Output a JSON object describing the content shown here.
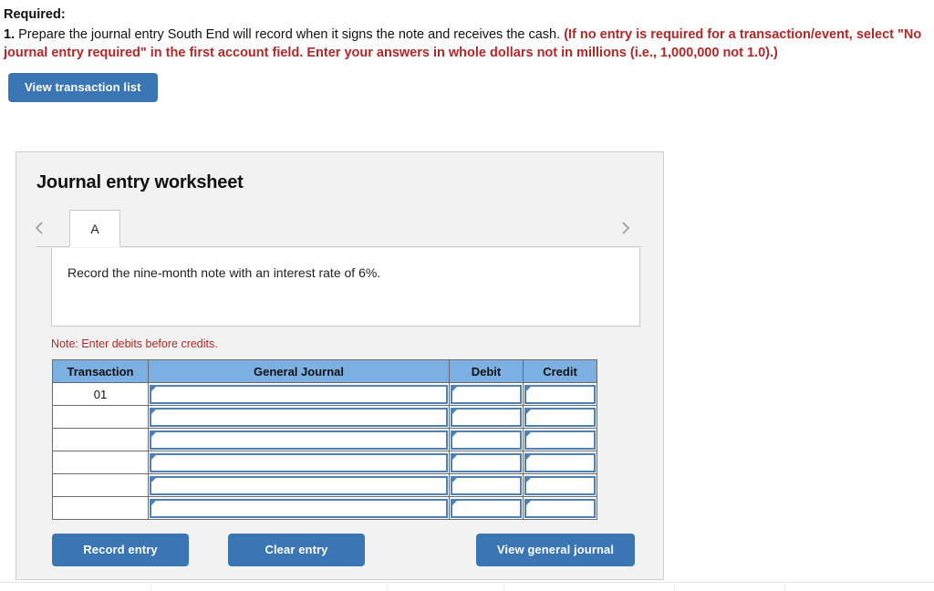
{
  "colors": {
    "button_blue": "#3a76b4",
    "table_header_blue": "#7db0e2",
    "field_border_blue": "#4e80b8",
    "warning_red": "#b02828",
    "panel_gray": "#f2f2f2"
  },
  "instructions": {
    "required_label": "Required:",
    "question_number": "1.",
    "question_text": " Prepare the journal entry South End will record when it signs the note and receives the cash. ",
    "parenthetical": "(If no entry is required for a transaction/event, select \"No journal entry required\" in the first account field. Enter your answers in whole dollars not in millions (i.e., 1,000,000 not 1.0).)"
  },
  "toolbar": {
    "view_transaction_list_label": "View transaction list"
  },
  "worksheet": {
    "title": "Journal entry worksheet",
    "prev_icon": "chevron-left-icon",
    "next_icon": "chevron-right-icon",
    "tabs": [
      {
        "label": "A",
        "active": true
      }
    ],
    "description": "Record the nine-month note with an interest rate of 6%.",
    "note": "Note: Enter debits before credits.",
    "table": {
      "columns": [
        "Transaction",
        "General Journal",
        "Debit",
        "Credit"
      ],
      "rows": [
        {
          "transaction": "01",
          "general_journal": "",
          "debit": "",
          "credit": ""
        },
        {
          "transaction": "",
          "general_journal": "",
          "debit": "",
          "credit": ""
        },
        {
          "transaction": "",
          "general_journal": "",
          "debit": "",
          "credit": ""
        },
        {
          "transaction": "",
          "general_journal": "",
          "debit": "",
          "credit": ""
        },
        {
          "transaction": "",
          "general_journal": "",
          "debit": "",
          "credit": ""
        },
        {
          "transaction": "",
          "general_journal": "",
          "debit": "",
          "credit": ""
        }
      ]
    },
    "actions": {
      "record_entry_label": "Record entry",
      "clear_entry_label": "Clear entry",
      "view_general_journal_label": "View general journal"
    }
  }
}
